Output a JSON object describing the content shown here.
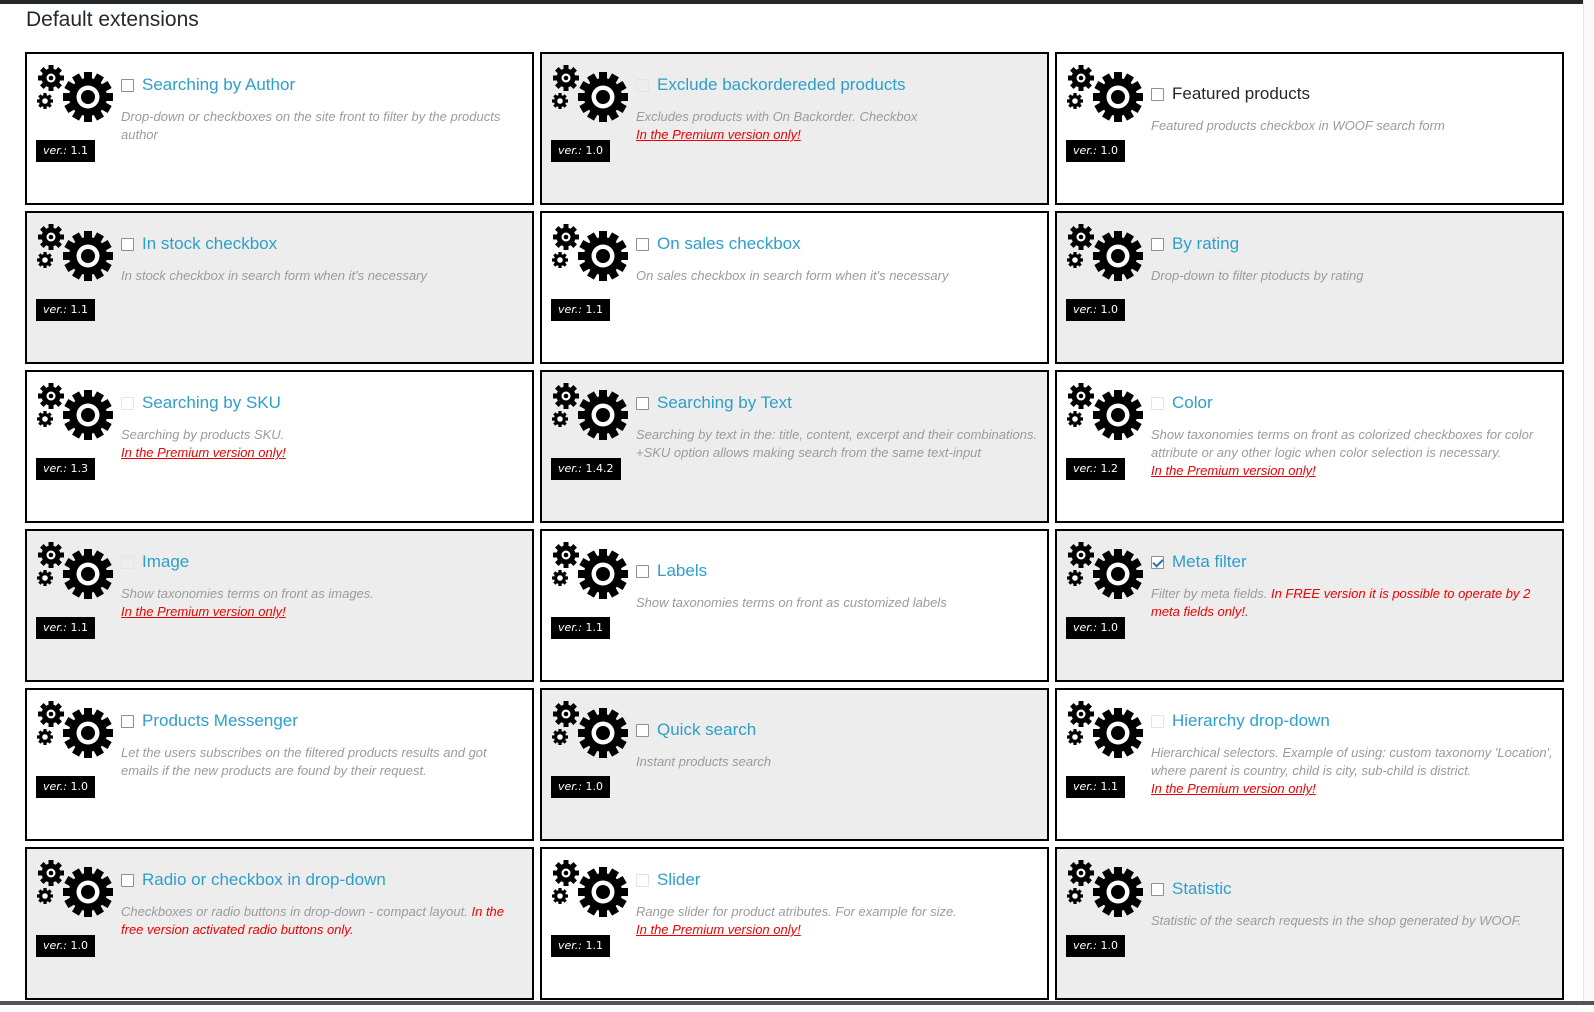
{
  "page": {
    "title": "Default extensions"
  },
  "common": {
    "ver_prefix": "ver.: ",
    "premium_note": "In the Premium version only!"
  },
  "extensions": [
    {
      "title": "Searching by Author",
      "desc": "Drop-down or checkboxes on the site front to filter by the products author",
      "extra": "",
      "ver": "1.1",
      "premium": false,
      "checkbox": "empty"
    },
    {
      "title": "Exclude backordereded products",
      "desc": "Excludes products with On Backorder. Checkbox",
      "extra": "",
      "ver": "1.0",
      "premium": true,
      "checkbox": "disabled"
    },
    {
      "title": "Featured products",
      "desc": "Featured products checkbox in WOOF search form",
      "extra": "",
      "ver": "1.0",
      "premium": false,
      "checkbox": "empty"
    },
    {
      "title": "In stock checkbox",
      "desc": "In stock checkbox in search form when it's necessary",
      "extra": "",
      "ver": "1.1",
      "premium": false,
      "checkbox": "empty"
    },
    {
      "title": "On sales checkbox",
      "desc": "On sales checkbox in search form when it's necessary",
      "extra": "",
      "ver": "1.1",
      "premium": false,
      "checkbox": "empty"
    },
    {
      "title": "By rating",
      "desc": "Drop-down to filter ptoducts by rating",
      "extra": "",
      "ver": "1.0",
      "premium": false,
      "checkbox": "empty"
    },
    {
      "title": "Searching by SKU",
      "desc": "Searching by products SKU.",
      "extra": "",
      "ver": "1.3",
      "premium": true,
      "checkbox": "disabled"
    },
    {
      "title": "Searching by Text",
      "desc": "Searching by text in the: title, content, excerpt and their combinations. +SKU option allows making search from the same text-input",
      "extra": "",
      "ver": "1.4.2",
      "premium": false,
      "checkbox": "empty"
    },
    {
      "title": "Color",
      "desc": "Show taxonomies terms on front as colorized checkboxes for color attribute or any other logic when color selection is necessary.",
      "extra": "",
      "ver": "1.2",
      "premium": true,
      "checkbox": "disabled"
    },
    {
      "title": "Image",
      "desc": "Show taxonomies terms on front as images.",
      "extra": "",
      "ver": "1.1",
      "premium": true,
      "checkbox": "disabled"
    },
    {
      "title": "Labels",
      "desc": "Show taxonomies terms on front as customized labels",
      "extra": "",
      "ver": "1.1",
      "premium": false,
      "checkbox": "empty"
    },
    {
      "title": "Meta filter",
      "desc": "Filter by meta fields.",
      "extra": "In FREE version it is possible to operate by 2 meta fields only!.",
      "ver": "1.0",
      "premium": false,
      "checkbox": "checked"
    },
    {
      "title": "Products Messenger",
      "desc": "Let the users subscribes on the filtered products results and got emails if the new products are found by their request.",
      "extra": "",
      "ver": "1.0",
      "premium": false,
      "checkbox": "empty"
    },
    {
      "title": "Quick search",
      "desc": "Instant products search",
      "extra": "",
      "ver": "1.0",
      "premium": false,
      "checkbox": "empty"
    },
    {
      "title": "Hierarchy drop-down",
      "desc": "Hierarchical selectors. Example of using: custom taxonomy 'Location', where parent is country, child is city, sub-child is district.",
      "extra": "",
      "ver": "1.1",
      "premium": true,
      "checkbox": "disabled"
    },
    {
      "title": "Radio or checkbox in drop-down",
      "desc": "Checkboxes or radio buttons in drop-down - compact layout.",
      "extra": "In the free version activated radio buttons only.",
      "ver": "1.0",
      "premium": false,
      "checkbox": "empty"
    },
    {
      "title": "Slider",
      "desc": "Range slider for product atributes. For example for size.",
      "extra": "",
      "ver": "1.1",
      "premium": true,
      "checkbox": "disabled"
    },
    {
      "title": "Statistic",
      "desc": "Statistic of the search requests in the shop generated by WOOF.",
      "extra": "",
      "ver": "1.0",
      "premium": false,
      "checkbox": "empty"
    }
  ],
  "colors": {
    "link": "#2e9fc9",
    "card_gray": "#ededed",
    "premium_red": "#ee0000",
    "ver_badge": "#000000"
  }
}
